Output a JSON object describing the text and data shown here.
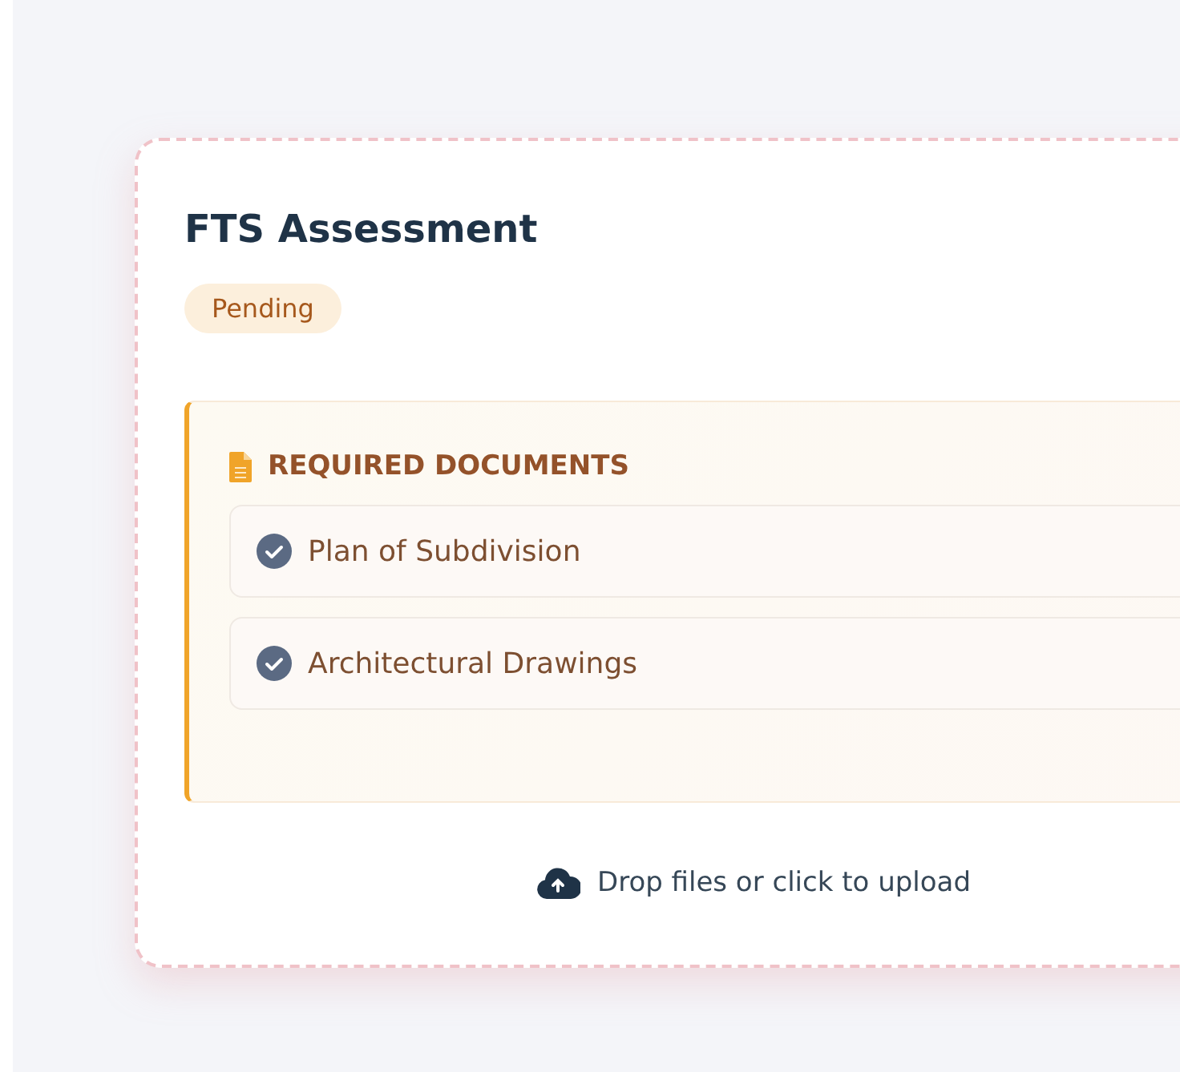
{
  "card": {
    "title": "FTS Assessment",
    "status": {
      "label": "Pending"
    },
    "documents": {
      "heading": "REQUIRED DOCUMENTS",
      "items": [
        {
          "name": "Plan of Subdivision",
          "checked": true
        },
        {
          "name": "Architectural Drawings",
          "checked": true
        }
      ]
    },
    "upload": {
      "label": "Drop files or click to upload"
    }
  }
}
